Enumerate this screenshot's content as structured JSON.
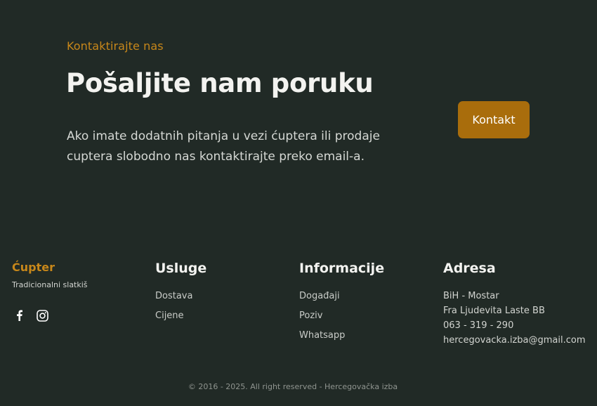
{
  "contact": {
    "eyebrow": "Kontaktirajte nas",
    "headline": "Pošaljite nam poruku",
    "lead": "Ako imate dodatnih pitanja u vezi ćuptera ili prodaje cuptera slobodno nas kontaktirajte preko email-a.",
    "button_label": "Kontakt"
  },
  "footer": {
    "brand": {
      "title": "Ćupter",
      "subtitle": "Tradicionalni slatkiš",
      "social": [
        "facebook-icon",
        "instagram-icon"
      ]
    },
    "services": {
      "title": "Usluge",
      "items": [
        "Dostava",
        "Cijene"
      ]
    },
    "info": {
      "title": "Informacije",
      "items": [
        "Događaji",
        "Poziv",
        "Whatsapp"
      ]
    },
    "address": {
      "title": "Adresa",
      "lines": [
        "BiH - Mostar",
        "Fra Ljudevita Laste BB",
        "063 - 319 - 290",
        "hercegovacka.izba@gmail.com"
      ]
    },
    "copyright": "© 2016 - 2025. All right reserved - Hercegovačka izba"
  },
  "colors": {
    "background": "#212a26",
    "accent": "#c7871a",
    "button": "#a96d0c",
    "heading": "#f3f3f0"
  }
}
